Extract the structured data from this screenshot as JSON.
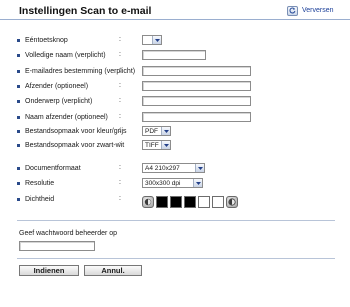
{
  "header": {
    "title": "Instellingen Scan to e-mail",
    "refresh_label": "Verversen"
  },
  "fields": [
    {
      "label": "Eéntoetsknop"
    },
    {
      "label": "Volledige naam (verplicht)"
    },
    {
      "label": "E-mailadres bestemming (verplicht)"
    },
    {
      "label": "Afzender (optioneel)"
    },
    {
      "label": "Onderwerp (verplicht)"
    },
    {
      "label": "Naam afzender (optioneel)"
    },
    {
      "label": "Bestandsopmaak voor kleur/grijs",
      "value": "PDF"
    },
    {
      "label": "Bestandsopmaak voor zwart-wit",
      "value": "TIFF"
    },
    {
      "label": "Documentformaat",
      "value": "A4 210x297"
    },
    {
      "label": "Resolutie",
      "value": "300x300 dpi"
    },
    {
      "label": "Dichtheid"
    }
  ],
  "density": {
    "levels": [
      "dark",
      "dark",
      "dark",
      "light",
      "light"
    ],
    "selected_index": 2,
    "decrease_icon": "density-decrease-icon",
    "increase_icon": "density-increase-icon"
  },
  "admin_password": {
    "label": "Geef wachtwoord beheerder op",
    "value": ""
  },
  "buttons": {
    "submit": "Indienen",
    "cancel": "Annul."
  },
  "colors": {
    "bullet": "#2a4a8a",
    "link": "#1b3f99",
    "divider": "#b8c4d8"
  }
}
